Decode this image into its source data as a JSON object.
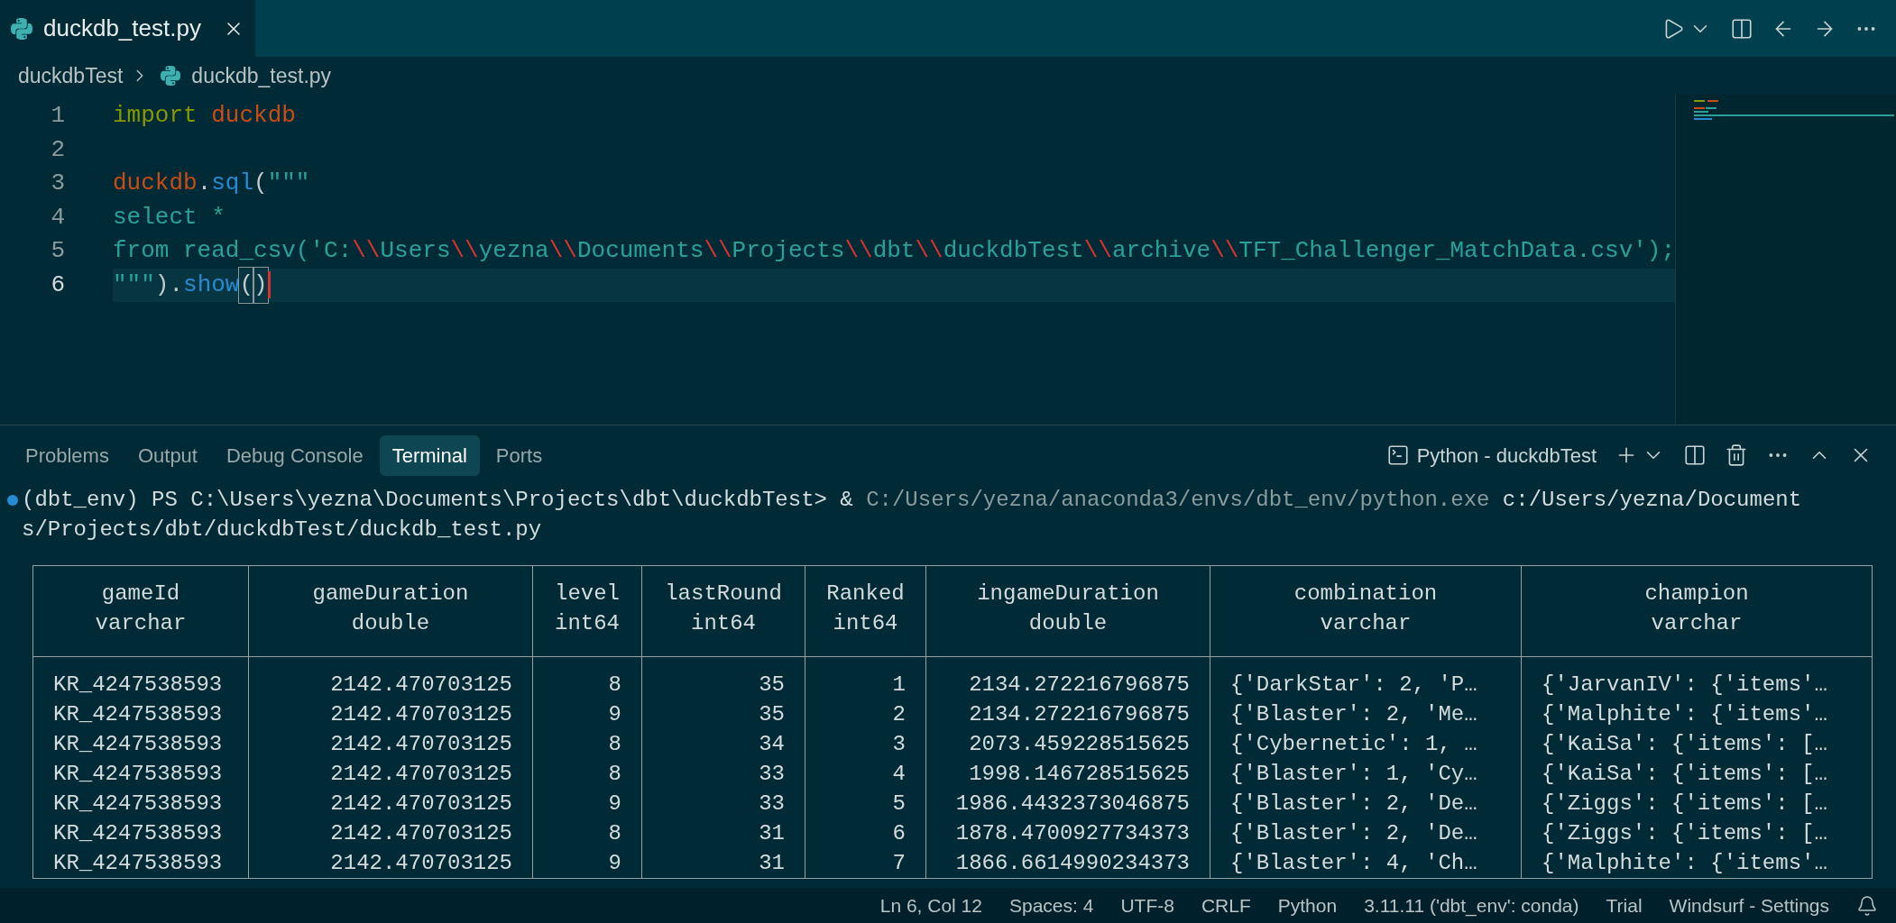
{
  "editor_tabs": [
    {
      "label": "duckdb_test.py",
      "selected": true
    }
  ],
  "breadcrumb": [
    "duckdbTest",
    "duckdb_test.py"
  ],
  "code_lines": [
    {
      "number": "1",
      "current": false,
      "tokens": [
        {
          "kind": "keyword",
          "text": "import"
        },
        {
          "kind": "module",
          "text": "duckdb",
          "space_before": true
        }
      ]
    },
    {
      "number": "2",
      "current": false
    },
    {
      "number": "3",
      "current": false,
      "tokens": [
        {
          "kind": "module",
          "text": "duckdb"
        },
        {
          "kind": "plain",
          "text": "."
        },
        {
          "kind": "func",
          "text": "sql"
        },
        {
          "kind": "plain",
          "text": "("
        },
        {
          "kind": "string",
          "text": "\"\"\""
        }
      ]
    },
    {
      "number": "4",
      "current": false,
      "tokens": [
        {
          "kind": "string",
          "text": "select *"
        }
      ]
    },
    {
      "number": "5",
      "current": false,
      "tokens": [
        {
          "kind": "string",
          "text": "from read_csv('C:"
        },
        {
          "kind": "escape",
          "text": "\\\\"
        },
        {
          "kind": "string",
          "text": "Users"
        },
        {
          "kind": "escape",
          "text": "\\\\"
        },
        {
          "kind": "string",
          "text": "yezna"
        },
        {
          "kind": "escape",
          "text": "\\\\"
        },
        {
          "kind": "string",
          "text": "Documents"
        },
        {
          "kind": "escape",
          "text": "\\\\"
        },
        {
          "kind": "string",
          "text": "Projects"
        },
        {
          "kind": "escape",
          "text": "\\\\"
        },
        {
          "kind": "string",
          "text": "dbt"
        },
        {
          "kind": "escape",
          "text": "\\\\"
        },
        {
          "kind": "string",
          "text": "duckdbTest"
        },
        {
          "kind": "escape",
          "text": "\\\\"
        },
        {
          "kind": "string",
          "text": "archive"
        },
        {
          "kind": "escape",
          "text": "\\\\"
        },
        {
          "kind": "string",
          "text": "TFT_Challenger_MatchData.csv');"
        }
      ]
    },
    {
      "number": "6",
      "current": true,
      "tokens": [
        {
          "kind": "string",
          "text": "\"\"\""
        },
        {
          "kind": "plain",
          "text": ")."
        },
        {
          "kind": "func",
          "text": "show"
        },
        {
          "kind": "bracket",
          "text": "("
        },
        {
          "kind": "bracket",
          "text": ")"
        }
      ]
    }
  ],
  "panel_tabs": [
    {
      "label": "Problems",
      "selected": false
    },
    {
      "label": "Output",
      "selected": false
    },
    {
      "label": "Debug Console",
      "selected": false
    },
    {
      "label": "Terminal",
      "selected": true
    },
    {
      "label": "Ports",
      "selected": false
    }
  ],
  "terminal_name": "Python - duckdbTest",
  "terminal_lines": [
    {
      "decorated": true,
      "segments": [
        {
          "kind": "plain",
          "text": "(dbt_env) PS C:\\Users\\yezna\\Documents\\Projects\\dbt\\duckdbTest> & "
        },
        {
          "kind": "dim",
          "text": "C:/Users/yezna/anaconda3/envs/dbt_env/python.exe"
        },
        {
          "kind": "plain",
          "text": " c:/Users/yezna/Document"
        }
      ]
    },
    {
      "decorated": false,
      "segments": [
        {
          "kind": "plain",
          "text": "s/Projects/dbt/duckdbTest/duckdb_test.py"
        }
      ]
    }
  ],
  "table": {
    "columns": [
      {
        "name": "gameId",
        "type": "varchar"
      },
      {
        "name": "gameDuration",
        "type": "double"
      },
      {
        "name": "level",
        "type": "int64"
      },
      {
        "name": "lastRound",
        "type": "int64"
      },
      {
        "name": "Ranked",
        "type": "int64"
      },
      {
        "name": "ingameDuration",
        "type": "double"
      },
      {
        "name": "combination",
        "type": "varchar"
      },
      {
        "name": "champion",
        "type": "varchar"
      }
    ],
    "rows": [
      [
        "KR_4247538593",
        "2142.470703125",
        "8",
        "35",
        "1",
        "2134.272216796875",
        "{'DarkStar': 2, 'P…",
        "{'JarvanIV': {'items'…"
      ],
      [
        "KR_4247538593",
        "2142.470703125",
        "9",
        "35",
        "2",
        "2134.272216796875",
        "{'Blaster': 2, 'Me…",
        "{'Malphite': {'items'…"
      ],
      [
        "KR_4247538593",
        "2142.470703125",
        "8",
        "34",
        "3",
        "2073.459228515625",
        "{'Cybernetic': 1, …",
        "{'KaiSa': {'items': […"
      ],
      [
        "KR_4247538593",
        "2142.470703125",
        "8",
        "33",
        "4",
        "1998.146728515625",
        "{'Blaster': 1, 'Cy…",
        "{'KaiSa': {'items': […"
      ],
      [
        "KR_4247538593",
        "2142.470703125",
        "9",
        "33",
        "5",
        "1986.4432373046875",
        "{'Blaster': 2, 'De…",
        "{'Ziggs': {'items': […"
      ],
      [
        "KR_4247538593",
        "2142.470703125",
        "8",
        "31",
        "6",
        "1878.4700927734373",
        "{'Blaster': 2, 'De…",
        "{'Ziggs': {'items': […"
      ],
      [
        "KR_4247538593",
        "2142.470703125",
        "9",
        "31",
        "7",
        "1866.6614990234373",
        "{'Blaster': 4, 'Ch…",
        "{'Malphite': {'items'…"
      ]
    ]
  },
  "status_bar": [
    "Ln 6, Col 12",
    "Spaces: 4",
    "UTF-8",
    "CRLF",
    "Python",
    "3.11.11 ('dbt_env': conda)",
    "Trial",
    "Windsurf - Settings"
  ]
}
